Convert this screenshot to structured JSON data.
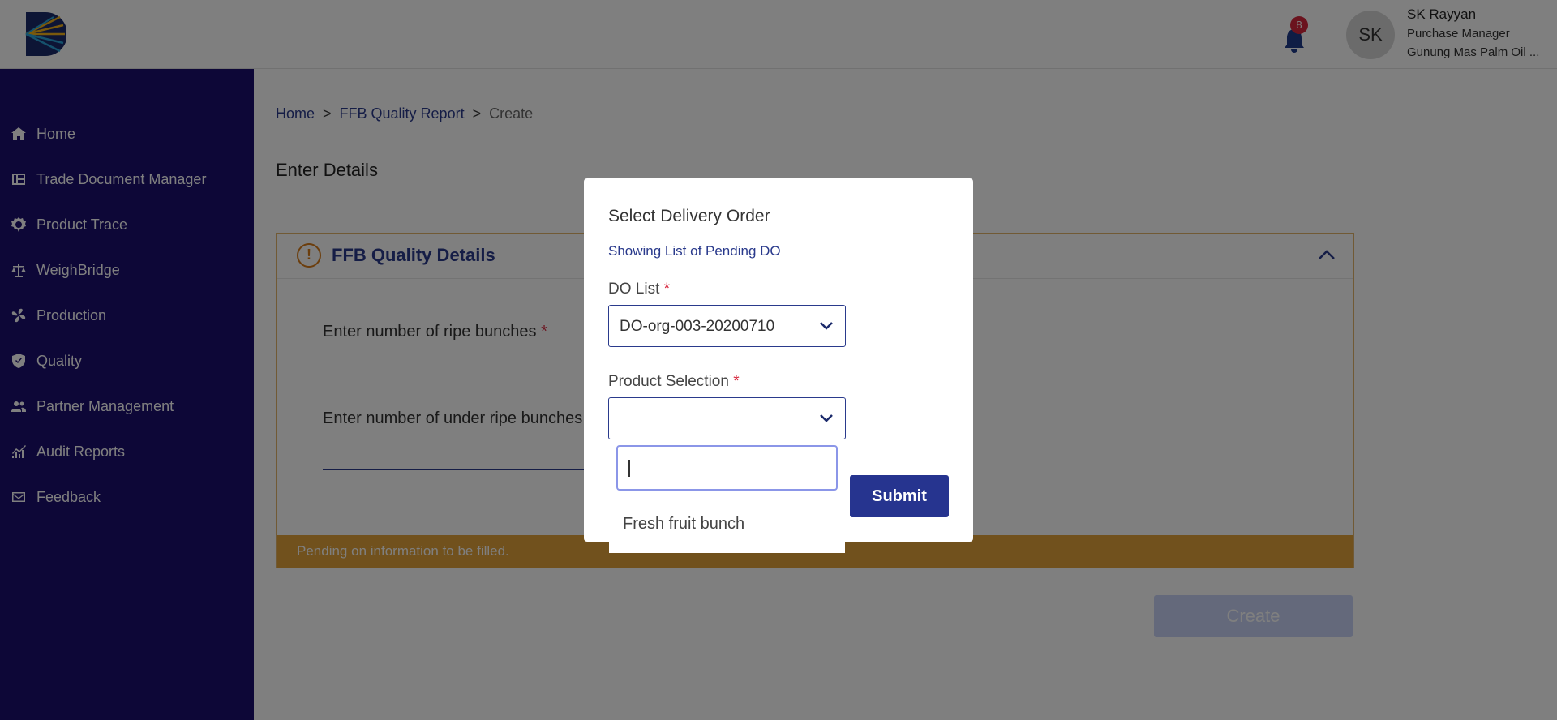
{
  "header": {
    "notification_count": "8",
    "avatar_initials": "SK",
    "user_name": "SK Rayyan",
    "user_role": "Purchase Manager",
    "user_org": "Gunung Mas Palm Oil ..."
  },
  "sidebar": {
    "items": [
      {
        "label": "Home",
        "icon": "home-icon"
      },
      {
        "label": "Trade Document Manager",
        "icon": "document-grid-icon"
      },
      {
        "label": "Product Trace",
        "icon": "gear-icon"
      },
      {
        "label": "WeighBridge",
        "icon": "scale-icon"
      },
      {
        "label": "Production",
        "icon": "fan-icon"
      },
      {
        "label": "Quality",
        "icon": "shield-check-icon"
      },
      {
        "label": "Partner Management",
        "icon": "people-icon"
      },
      {
        "label": "Audit Reports",
        "icon": "chart-icon"
      },
      {
        "label": "Feedback",
        "icon": "mail-icon"
      }
    ]
  },
  "breadcrumb": {
    "home": "Home",
    "sep": ">",
    "report": "FFB Quality Report",
    "current": "Create"
  },
  "main": {
    "section_title": "Enter Details",
    "card_title": "FFB Quality Details",
    "field_ripe": "Enter number of ripe bunches",
    "field_under_ripe": "Enter number of under ripe bunches",
    "required_mark": "*",
    "pending_text": "Pending on information to be filled.",
    "create_label": "Create"
  },
  "modal": {
    "title": "Select Delivery Order",
    "subtitle": "Showing List of Pending DO",
    "do_list_label": "DO List",
    "do_list_value": "DO-org-003-20200710",
    "product_label": "Product Selection",
    "product_value": "",
    "submit_label": "Submit",
    "dropdown": {
      "search_value": "",
      "options": [
        "Fresh fruit bunch"
      ]
    }
  },
  "colors": {
    "sidebar_bg": "#1a0e6e",
    "accent": "#2a3a8c",
    "warning": "#e2a23a",
    "required": "#d7263d"
  }
}
